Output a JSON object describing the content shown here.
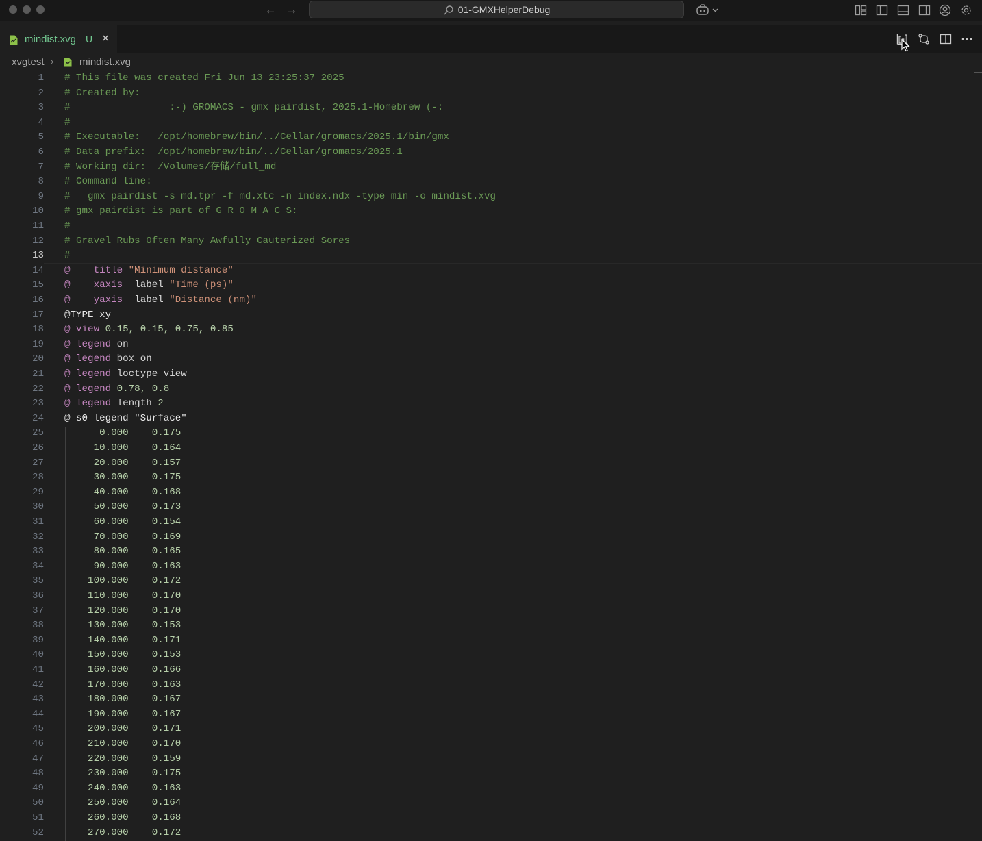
{
  "window": {
    "search_title": "01-GMXHelperDebug"
  },
  "tab": {
    "file_name": "mindist.xvg",
    "status": "U"
  },
  "breadcrumb": {
    "folder": "xvgtest",
    "file": "mindist.xvg"
  },
  "editor": {
    "active_line": 13,
    "lines": [
      {
        "n": "1",
        "segs": [
          [
            "c",
            "# This file was created Fri Jun 13 23:25:37 2025"
          ]
        ]
      },
      {
        "n": "2",
        "segs": [
          [
            "c",
            "# Created by:"
          ]
        ]
      },
      {
        "n": "3",
        "segs": [
          [
            "c",
            "#                 :-) GROMACS - gmx pairdist, 2025.1-Homebrew (-:"
          ]
        ]
      },
      {
        "n": "4",
        "segs": [
          [
            "c",
            "#"
          ]
        ]
      },
      {
        "n": "5",
        "segs": [
          [
            "c",
            "# Executable:   /opt/homebrew/bin/../Cellar/gromacs/2025.1/bin/gmx"
          ]
        ]
      },
      {
        "n": "6",
        "segs": [
          [
            "c",
            "# Data prefix:  /opt/homebrew/bin/../Cellar/gromacs/2025.1"
          ]
        ]
      },
      {
        "n": "7",
        "segs": [
          [
            "c",
            "# Working dir:  /Volumes/存储/full_md"
          ]
        ]
      },
      {
        "n": "8",
        "segs": [
          [
            "c",
            "# Command line:"
          ]
        ]
      },
      {
        "n": "9",
        "segs": [
          [
            "c",
            "#   gmx pairdist -s md.tpr -f md.xtc -n index.ndx -type min -o mindist.xvg"
          ]
        ]
      },
      {
        "n": "10",
        "segs": [
          [
            "c",
            "# gmx pairdist is part of G R O M A C S:"
          ]
        ]
      },
      {
        "n": "11",
        "segs": [
          [
            "c",
            "#"
          ]
        ]
      },
      {
        "n": "12",
        "segs": [
          [
            "c",
            "# Gravel Rubs Often Many Awfully Cauterized Sores"
          ]
        ]
      },
      {
        "n": "13",
        "segs": [
          [
            "c",
            "#"
          ]
        ]
      },
      {
        "n": "14",
        "segs": [
          [
            "a",
            "@"
          ],
          [
            "t",
            "    "
          ],
          [
            "k",
            "title"
          ],
          [
            "t",
            " "
          ],
          [
            "s",
            "\"Minimum distance\""
          ]
        ]
      },
      {
        "n": "15",
        "segs": [
          [
            "a",
            "@"
          ],
          [
            "t",
            "    "
          ],
          [
            "k",
            "xaxis"
          ],
          [
            "t",
            "  label "
          ],
          [
            "s",
            "\"Time (ps)\""
          ]
        ]
      },
      {
        "n": "16",
        "segs": [
          [
            "a",
            "@"
          ],
          [
            "t",
            "    "
          ],
          [
            "k",
            "yaxis"
          ],
          [
            "t",
            "  label "
          ],
          [
            "s",
            "\"Distance (nm)\""
          ]
        ]
      },
      {
        "n": "17",
        "segs": [
          [
            "p",
            "@TYPE xy"
          ]
        ]
      },
      {
        "n": "18",
        "segs": [
          [
            "a",
            "@"
          ],
          [
            "t",
            " "
          ],
          [
            "k",
            "view"
          ],
          [
            "t",
            " "
          ],
          [
            "m",
            "0.15, 0.15, 0.75, 0.85"
          ]
        ]
      },
      {
        "n": "19",
        "segs": [
          [
            "a",
            "@"
          ],
          [
            "t",
            " "
          ],
          [
            "k",
            "legend"
          ],
          [
            "t",
            " on"
          ]
        ]
      },
      {
        "n": "20",
        "segs": [
          [
            "a",
            "@"
          ],
          [
            "t",
            " "
          ],
          [
            "k",
            "legend"
          ],
          [
            "t",
            " box on"
          ]
        ]
      },
      {
        "n": "21",
        "segs": [
          [
            "a",
            "@"
          ],
          [
            "t",
            " "
          ],
          [
            "k",
            "legend"
          ],
          [
            "t",
            " loctype view"
          ]
        ]
      },
      {
        "n": "22",
        "segs": [
          [
            "a",
            "@"
          ],
          [
            "t",
            " "
          ],
          [
            "k",
            "legend"
          ],
          [
            "t",
            " "
          ],
          [
            "m",
            "0.78, 0.8"
          ]
        ]
      },
      {
        "n": "23",
        "segs": [
          [
            "a",
            "@"
          ],
          [
            "t",
            " "
          ],
          [
            "k",
            "legend"
          ],
          [
            "t",
            " length "
          ],
          [
            "m",
            "2"
          ]
        ]
      },
      {
        "n": "24",
        "segs": [
          [
            "p",
            "@ s0 legend "
          ],
          [
            "p",
            "\"Surface\""
          ]
        ]
      },
      {
        "n": "25",
        "segs": [
          [
            "m",
            "      0.000    0.175"
          ]
        ]
      },
      {
        "n": "26",
        "segs": [
          [
            "m",
            "     10.000    0.164"
          ]
        ]
      },
      {
        "n": "27",
        "segs": [
          [
            "m",
            "     20.000    0.157"
          ]
        ]
      },
      {
        "n": "28",
        "segs": [
          [
            "m",
            "     30.000    0.175"
          ]
        ]
      },
      {
        "n": "29",
        "segs": [
          [
            "m",
            "     40.000    0.168"
          ]
        ]
      },
      {
        "n": "30",
        "segs": [
          [
            "m",
            "     50.000    0.173"
          ]
        ]
      },
      {
        "n": "31",
        "segs": [
          [
            "m",
            "     60.000    0.154"
          ]
        ]
      },
      {
        "n": "32",
        "segs": [
          [
            "m",
            "     70.000    0.169"
          ]
        ]
      },
      {
        "n": "33",
        "segs": [
          [
            "m",
            "     80.000    0.165"
          ]
        ]
      },
      {
        "n": "34",
        "segs": [
          [
            "m",
            "     90.000    0.163"
          ]
        ]
      },
      {
        "n": "35",
        "segs": [
          [
            "m",
            "    100.000    0.172"
          ]
        ]
      },
      {
        "n": "36",
        "segs": [
          [
            "m",
            "    110.000    0.170"
          ]
        ]
      },
      {
        "n": "37",
        "segs": [
          [
            "m",
            "    120.000    0.170"
          ]
        ]
      },
      {
        "n": "38",
        "segs": [
          [
            "m",
            "    130.000    0.153"
          ]
        ]
      },
      {
        "n": "39",
        "segs": [
          [
            "m",
            "    140.000    0.171"
          ]
        ]
      },
      {
        "n": "40",
        "segs": [
          [
            "m",
            "    150.000    0.153"
          ]
        ]
      },
      {
        "n": "41",
        "segs": [
          [
            "m",
            "    160.000    0.166"
          ]
        ]
      },
      {
        "n": "42",
        "segs": [
          [
            "m",
            "    170.000    0.163"
          ]
        ]
      },
      {
        "n": "43",
        "segs": [
          [
            "m",
            "    180.000    0.167"
          ]
        ]
      },
      {
        "n": "44",
        "segs": [
          [
            "m",
            "    190.000    0.167"
          ]
        ]
      },
      {
        "n": "45",
        "segs": [
          [
            "m",
            "    200.000    0.171"
          ]
        ]
      },
      {
        "n": "46",
        "segs": [
          [
            "m",
            "    210.000    0.170"
          ]
        ]
      },
      {
        "n": "47",
        "segs": [
          [
            "m",
            "    220.000    0.159"
          ]
        ]
      },
      {
        "n": "48",
        "segs": [
          [
            "m",
            "    230.000    0.175"
          ]
        ]
      },
      {
        "n": "49",
        "segs": [
          [
            "m",
            "    240.000    0.163"
          ]
        ]
      },
      {
        "n": "50",
        "segs": [
          [
            "m",
            "    250.000    0.164"
          ]
        ]
      },
      {
        "n": "51",
        "segs": [
          [
            "m",
            "    260.000    0.168"
          ]
        ]
      },
      {
        "n": "52",
        "segs": [
          [
            "m",
            "    270.000    0.172"
          ]
        ]
      }
    ]
  },
  "colors": {
    "comment": "#6a9955",
    "keyword": "#c586c0",
    "string": "#ce9178",
    "number": "#b5cea8",
    "modified": "#73c991"
  },
  "icons": {
    "titlebar_right": [
      "layout-icon",
      "toggle-primary-sidebar-icon",
      "toggle-panel-icon",
      "toggle-secondary-sidebar-icon",
      "account-icon",
      "settings-gear-icon"
    ],
    "editor_actions": [
      "plot-chart-icon",
      "open-changes-icon",
      "split-editor-icon",
      "more-actions-icon"
    ]
  }
}
